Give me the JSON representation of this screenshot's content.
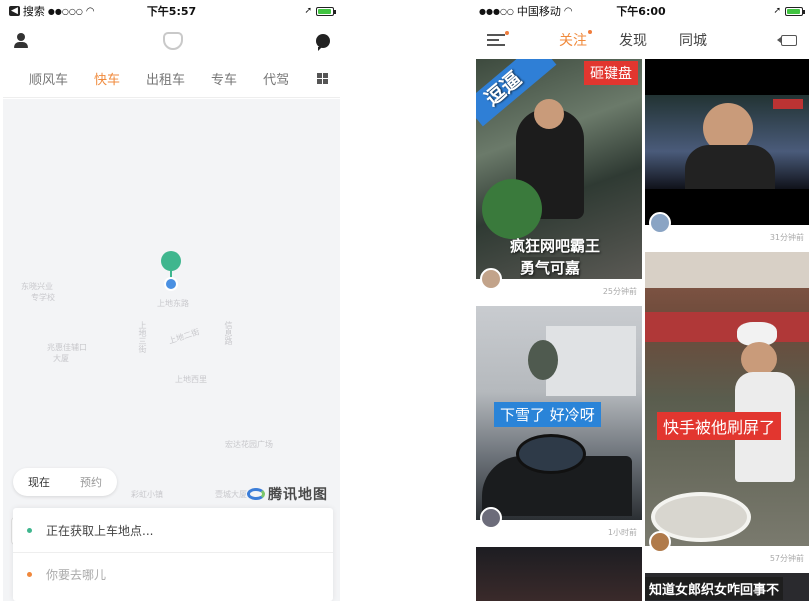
{
  "left_screen": {
    "status": {
      "back_app": "搜索",
      "signal": "●●○○○",
      "time": "下午5:57"
    },
    "tabs": [
      "顺风车",
      "快车",
      "出租车",
      "专车",
      "代驾"
    ],
    "active_tab": "快车",
    "map_labels": [
      "东晓兴业",
      "专学校",
      "上地东路",
      "上地三街",
      "上地二街",
      "信息路",
      "兆惠佳辅口",
      "大厦",
      "上地西里",
      "宏达花园广场",
      "彩虹小镇",
      "壹城大厦"
    ],
    "time_toggle": [
      "现在",
      "预约"
    ],
    "map_provider": "腾讯地图",
    "pickup_text": "正在获取上车地点...",
    "destination_placeholder": "你要去哪儿",
    "colors": {
      "accent": "#f08a3c",
      "pickup_dot": "#3fb68e",
      "dest_dot": "#f0883c"
    }
  },
  "right_screen": {
    "status": {
      "signal": "●●●○○",
      "carrier": "中国移动",
      "time": "下午6:00"
    },
    "tabs": [
      "关注",
      "发现",
      "同城"
    ],
    "active_tab": "关注",
    "feed": [
      {
        "tag_corner": "逗逼",
        "tag_red": "砸键盘",
        "caption_line1": "疯狂网吧霸王",
        "caption_line2": "勇气可嘉",
        "ago": "25分钟前"
      },
      {
        "ago": "31分钟前"
      },
      {
        "blue_caption": "下雪了 好冷呀",
        "ago": "1小时前"
      },
      {
        "red_caption": "快手被他刷屏了",
        "ago": "57分钟前"
      },
      {
        "dark_caption": "知道女郎织女咋回事不"
      }
    ]
  }
}
